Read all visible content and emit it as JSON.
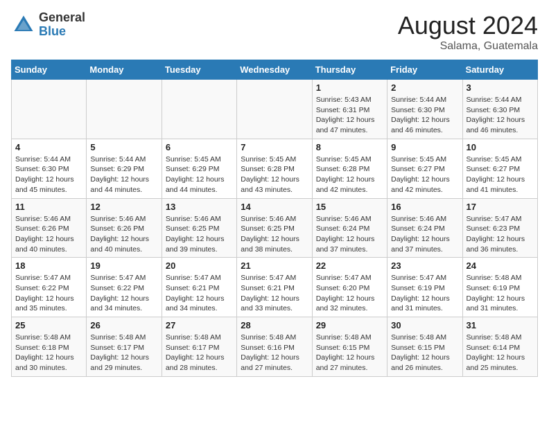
{
  "header": {
    "logo_general": "General",
    "logo_blue": "Blue",
    "title": "August 2024",
    "subtitle": "Salama, Guatemala"
  },
  "days_of_week": [
    "Sunday",
    "Monday",
    "Tuesday",
    "Wednesday",
    "Thursday",
    "Friday",
    "Saturday"
  ],
  "weeks": [
    [
      {
        "day": "",
        "info": ""
      },
      {
        "day": "",
        "info": ""
      },
      {
        "day": "",
        "info": ""
      },
      {
        "day": "",
        "info": ""
      },
      {
        "day": "1",
        "info": "Sunrise: 5:43 AM\nSunset: 6:31 PM\nDaylight: 12 hours and 47 minutes."
      },
      {
        "day": "2",
        "info": "Sunrise: 5:44 AM\nSunset: 6:30 PM\nDaylight: 12 hours and 46 minutes."
      },
      {
        "day": "3",
        "info": "Sunrise: 5:44 AM\nSunset: 6:30 PM\nDaylight: 12 hours and 46 minutes."
      }
    ],
    [
      {
        "day": "4",
        "info": "Sunrise: 5:44 AM\nSunset: 6:30 PM\nDaylight: 12 hours and 45 minutes."
      },
      {
        "day": "5",
        "info": "Sunrise: 5:44 AM\nSunset: 6:29 PM\nDaylight: 12 hours and 44 minutes."
      },
      {
        "day": "6",
        "info": "Sunrise: 5:45 AM\nSunset: 6:29 PM\nDaylight: 12 hours and 44 minutes."
      },
      {
        "day": "7",
        "info": "Sunrise: 5:45 AM\nSunset: 6:28 PM\nDaylight: 12 hours and 43 minutes."
      },
      {
        "day": "8",
        "info": "Sunrise: 5:45 AM\nSunset: 6:28 PM\nDaylight: 12 hours and 42 minutes."
      },
      {
        "day": "9",
        "info": "Sunrise: 5:45 AM\nSunset: 6:27 PM\nDaylight: 12 hours and 42 minutes."
      },
      {
        "day": "10",
        "info": "Sunrise: 5:45 AM\nSunset: 6:27 PM\nDaylight: 12 hours and 41 minutes."
      }
    ],
    [
      {
        "day": "11",
        "info": "Sunrise: 5:46 AM\nSunset: 6:26 PM\nDaylight: 12 hours and 40 minutes."
      },
      {
        "day": "12",
        "info": "Sunrise: 5:46 AM\nSunset: 6:26 PM\nDaylight: 12 hours and 40 minutes."
      },
      {
        "day": "13",
        "info": "Sunrise: 5:46 AM\nSunset: 6:25 PM\nDaylight: 12 hours and 39 minutes."
      },
      {
        "day": "14",
        "info": "Sunrise: 5:46 AM\nSunset: 6:25 PM\nDaylight: 12 hours and 38 minutes."
      },
      {
        "day": "15",
        "info": "Sunrise: 5:46 AM\nSunset: 6:24 PM\nDaylight: 12 hours and 37 minutes."
      },
      {
        "day": "16",
        "info": "Sunrise: 5:46 AM\nSunset: 6:24 PM\nDaylight: 12 hours and 37 minutes."
      },
      {
        "day": "17",
        "info": "Sunrise: 5:47 AM\nSunset: 6:23 PM\nDaylight: 12 hours and 36 minutes."
      }
    ],
    [
      {
        "day": "18",
        "info": "Sunrise: 5:47 AM\nSunset: 6:22 PM\nDaylight: 12 hours and 35 minutes."
      },
      {
        "day": "19",
        "info": "Sunrise: 5:47 AM\nSunset: 6:22 PM\nDaylight: 12 hours and 34 minutes."
      },
      {
        "day": "20",
        "info": "Sunrise: 5:47 AM\nSunset: 6:21 PM\nDaylight: 12 hours and 34 minutes."
      },
      {
        "day": "21",
        "info": "Sunrise: 5:47 AM\nSunset: 6:21 PM\nDaylight: 12 hours and 33 minutes."
      },
      {
        "day": "22",
        "info": "Sunrise: 5:47 AM\nSunset: 6:20 PM\nDaylight: 12 hours and 32 minutes."
      },
      {
        "day": "23",
        "info": "Sunrise: 5:47 AM\nSunset: 6:19 PM\nDaylight: 12 hours and 31 minutes."
      },
      {
        "day": "24",
        "info": "Sunrise: 5:48 AM\nSunset: 6:19 PM\nDaylight: 12 hours and 31 minutes."
      }
    ],
    [
      {
        "day": "25",
        "info": "Sunrise: 5:48 AM\nSunset: 6:18 PM\nDaylight: 12 hours and 30 minutes."
      },
      {
        "day": "26",
        "info": "Sunrise: 5:48 AM\nSunset: 6:17 PM\nDaylight: 12 hours and 29 minutes."
      },
      {
        "day": "27",
        "info": "Sunrise: 5:48 AM\nSunset: 6:17 PM\nDaylight: 12 hours and 28 minutes."
      },
      {
        "day": "28",
        "info": "Sunrise: 5:48 AM\nSunset: 6:16 PM\nDaylight: 12 hours and 27 minutes."
      },
      {
        "day": "29",
        "info": "Sunrise: 5:48 AM\nSunset: 6:15 PM\nDaylight: 12 hours and 27 minutes."
      },
      {
        "day": "30",
        "info": "Sunrise: 5:48 AM\nSunset: 6:15 PM\nDaylight: 12 hours and 26 minutes."
      },
      {
        "day": "31",
        "info": "Sunrise: 5:48 AM\nSunset: 6:14 PM\nDaylight: 12 hours and 25 minutes."
      }
    ]
  ]
}
